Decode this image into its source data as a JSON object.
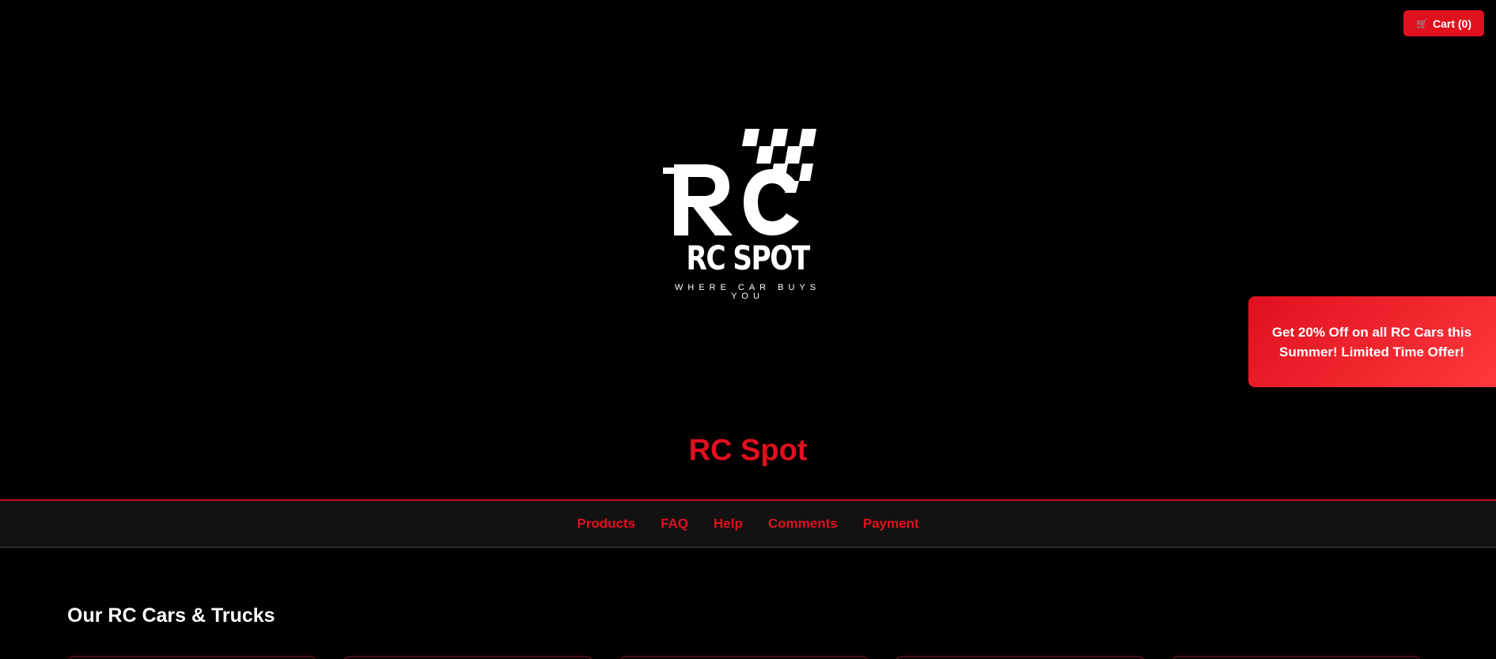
{
  "cart": {
    "icon": "cart-icon",
    "label": "Cart (0)"
  },
  "logo": {
    "letters": "RC",
    "name": "RC SPOT",
    "tagline": "WHERE CAR BUYS YOU"
  },
  "promo": {
    "text": "Get 20% Off on all RC Cars this Summer! Limited Time Offer!"
  },
  "header": {
    "title": "RC Spot"
  },
  "nav": {
    "items": [
      {
        "label": "Products"
      },
      {
        "label": "FAQ"
      },
      {
        "label": "Help"
      },
      {
        "label": "Comments"
      },
      {
        "label": "Payment"
      }
    ]
  },
  "products": {
    "section_title": "Our RC Cars & Trucks",
    "cards_visible": 5
  },
  "colors": {
    "accent": "#e0101e",
    "background": "#000000",
    "nav_background": "#111111",
    "text": "#ffffff"
  }
}
